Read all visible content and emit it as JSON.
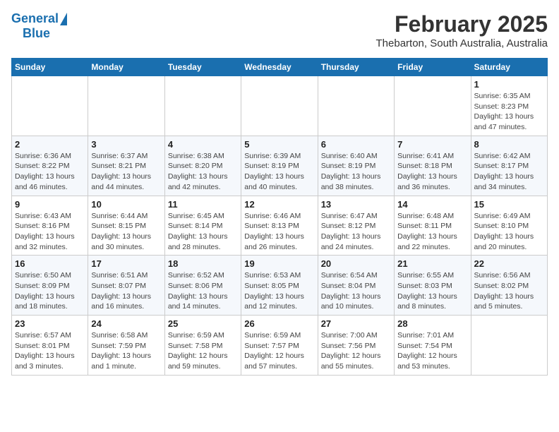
{
  "logo": {
    "general": "General",
    "blue": "Blue"
  },
  "title": "February 2025",
  "subtitle": "Thebarton, South Australia, Australia",
  "days_of_week": [
    "Sunday",
    "Monday",
    "Tuesday",
    "Wednesday",
    "Thursday",
    "Friday",
    "Saturday"
  ],
  "weeks": [
    [
      {
        "day": "",
        "info": ""
      },
      {
        "day": "",
        "info": ""
      },
      {
        "day": "",
        "info": ""
      },
      {
        "day": "",
        "info": ""
      },
      {
        "day": "",
        "info": ""
      },
      {
        "day": "",
        "info": ""
      },
      {
        "day": "1",
        "info": "Sunrise: 6:35 AM\nSunset: 8:23 PM\nDaylight: 13 hours\nand 47 minutes."
      }
    ],
    [
      {
        "day": "2",
        "info": "Sunrise: 6:36 AM\nSunset: 8:22 PM\nDaylight: 13 hours\nand 46 minutes."
      },
      {
        "day": "3",
        "info": "Sunrise: 6:37 AM\nSunset: 8:21 PM\nDaylight: 13 hours\nand 44 minutes."
      },
      {
        "day": "4",
        "info": "Sunrise: 6:38 AM\nSunset: 8:20 PM\nDaylight: 13 hours\nand 42 minutes."
      },
      {
        "day": "5",
        "info": "Sunrise: 6:39 AM\nSunset: 8:19 PM\nDaylight: 13 hours\nand 40 minutes."
      },
      {
        "day": "6",
        "info": "Sunrise: 6:40 AM\nSunset: 8:19 PM\nDaylight: 13 hours\nand 38 minutes."
      },
      {
        "day": "7",
        "info": "Sunrise: 6:41 AM\nSunset: 8:18 PM\nDaylight: 13 hours\nand 36 minutes."
      },
      {
        "day": "8",
        "info": "Sunrise: 6:42 AM\nSunset: 8:17 PM\nDaylight: 13 hours\nand 34 minutes."
      }
    ],
    [
      {
        "day": "9",
        "info": "Sunrise: 6:43 AM\nSunset: 8:16 PM\nDaylight: 13 hours\nand 32 minutes."
      },
      {
        "day": "10",
        "info": "Sunrise: 6:44 AM\nSunset: 8:15 PM\nDaylight: 13 hours\nand 30 minutes."
      },
      {
        "day": "11",
        "info": "Sunrise: 6:45 AM\nSunset: 8:14 PM\nDaylight: 13 hours\nand 28 minutes."
      },
      {
        "day": "12",
        "info": "Sunrise: 6:46 AM\nSunset: 8:13 PM\nDaylight: 13 hours\nand 26 minutes."
      },
      {
        "day": "13",
        "info": "Sunrise: 6:47 AM\nSunset: 8:12 PM\nDaylight: 13 hours\nand 24 minutes."
      },
      {
        "day": "14",
        "info": "Sunrise: 6:48 AM\nSunset: 8:11 PM\nDaylight: 13 hours\nand 22 minutes."
      },
      {
        "day": "15",
        "info": "Sunrise: 6:49 AM\nSunset: 8:10 PM\nDaylight: 13 hours\nand 20 minutes."
      }
    ],
    [
      {
        "day": "16",
        "info": "Sunrise: 6:50 AM\nSunset: 8:09 PM\nDaylight: 13 hours\nand 18 minutes."
      },
      {
        "day": "17",
        "info": "Sunrise: 6:51 AM\nSunset: 8:07 PM\nDaylight: 13 hours\nand 16 minutes."
      },
      {
        "day": "18",
        "info": "Sunrise: 6:52 AM\nSunset: 8:06 PM\nDaylight: 13 hours\nand 14 minutes."
      },
      {
        "day": "19",
        "info": "Sunrise: 6:53 AM\nSunset: 8:05 PM\nDaylight: 13 hours\nand 12 minutes."
      },
      {
        "day": "20",
        "info": "Sunrise: 6:54 AM\nSunset: 8:04 PM\nDaylight: 13 hours\nand 10 minutes."
      },
      {
        "day": "21",
        "info": "Sunrise: 6:55 AM\nSunset: 8:03 PM\nDaylight: 13 hours\nand 8 minutes."
      },
      {
        "day": "22",
        "info": "Sunrise: 6:56 AM\nSunset: 8:02 PM\nDaylight: 13 hours\nand 5 minutes."
      }
    ],
    [
      {
        "day": "23",
        "info": "Sunrise: 6:57 AM\nSunset: 8:01 PM\nDaylight: 13 hours\nand 3 minutes."
      },
      {
        "day": "24",
        "info": "Sunrise: 6:58 AM\nSunset: 7:59 PM\nDaylight: 13 hours\nand 1 minute."
      },
      {
        "day": "25",
        "info": "Sunrise: 6:59 AM\nSunset: 7:58 PM\nDaylight: 12 hours\nand 59 minutes."
      },
      {
        "day": "26",
        "info": "Sunrise: 6:59 AM\nSunset: 7:57 PM\nDaylight: 12 hours\nand 57 minutes."
      },
      {
        "day": "27",
        "info": "Sunrise: 7:00 AM\nSunset: 7:56 PM\nDaylight: 12 hours\nand 55 minutes."
      },
      {
        "day": "28",
        "info": "Sunrise: 7:01 AM\nSunset: 7:54 PM\nDaylight: 12 hours\nand 53 minutes."
      },
      {
        "day": "",
        "info": ""
      }
    ]
  ]
}
